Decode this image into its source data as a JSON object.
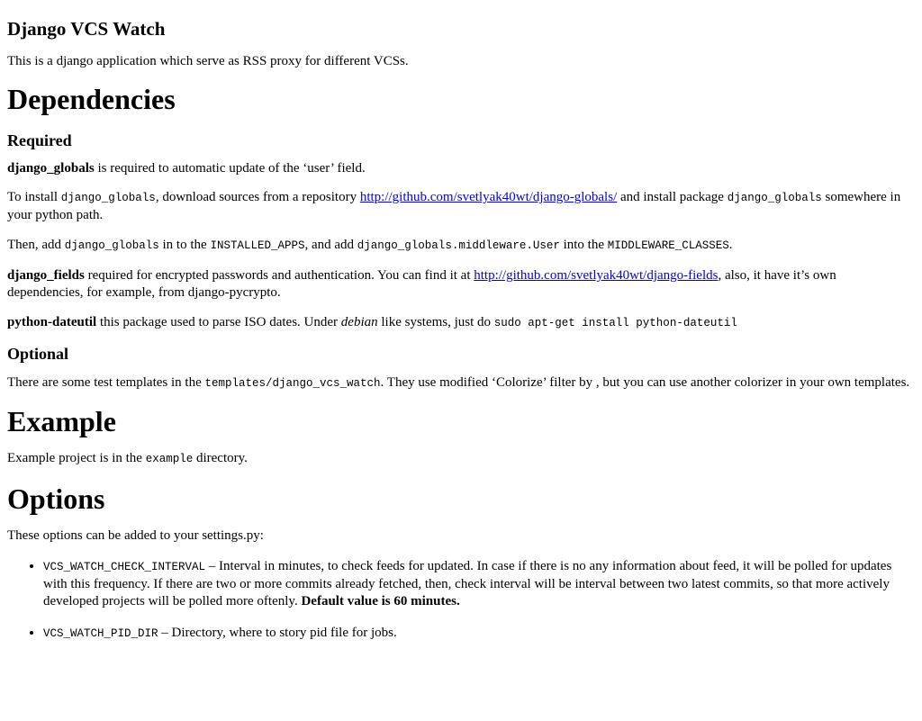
{
  "title": "Django VCS Watch",
  "intro": "This is a django application which serve as RSS proxy for different VCSs.",
  "dependencies": {
    "heading": "Dependencies",
    "required_heading": "Required",
    "globals_name": "django_globals",
    "globals_text": " is required to automatic update of the ‘user’ field.",
    "install_1": "To install ",
    "install_code1": "django_globals",
    "install_2": ", download sources from a repository ",
    "install_link": "http://github.com/svetlyak40wt/django-globals/",
    "install_3": " and install package ",
    "install_code2": "django_globals",
    "install_4": " somewhere in your python path.",
    "add_1": "Then, add ",
    "add_code1": "django_globals",
    "add_2": " in to the ",
    "add_code2": "INSTALLED_APPS",
    "add_3": ", and add ",
    "add_code3": "django_globals.middleware.User",
    "add_4": " into the ",
    "add_code4": "MIDDLEWARE_CLASSES",
    "add_5": ".",
    "fields_name": "django_fields",
    "fields_1": " required for encrypted passwords and authentication. You can find it at ",
    "fields_link": "http://github.com/svetlyak40wt/django-fields",
    "fields_2": ", also, it have it’s own dependencies, for example, from django-pycrypto.",
    "dateutil_name": "python-dateutil",
    "dateutil_1": " this package used to parse ISO dates. Under ",
    "dateutil_em": "debian",
    "dateutil_2": " like systems, just do ",
    "dateutil_code": "sudo apt-get install python-dateutil",
    "optional_heading": "Optional",
    "opt_1": "There are some test templates in the ",
    "opt_code": "templates/django_vcs_watch",
    "opt_2": ". They use modified ‘Colorize’ filter by , but you can use another colorizer in your own templates."
  },
  "example": {
    "heading": "Example",
    "text_1": "Example project is in the ",
    "text_code": "example",
    "text_2": " directory."
  },
  "options": {
    "heading": "Options",
    "intro": "These options can be added to your settings.py:",
    "interval_code": "VCS_WATCH_CHECK_INTERVAL",
    "interval_text": " – Interval in minutes, to check feeds for updated. In case if there is no any information about feed, it will be polled for updates with this frequency. If there are two or more commits already fetched, then, check interval will be interval between two latest commits, so that more actively developed projects will be polled more oftenly. ",
    "interval_bold": "Default value is 60 minutes.",
    "pid_code": "VCS_WATCH_PID_DIR",
    "pid_text": " – Directory, where to story pid file for jobs."
  }
}
